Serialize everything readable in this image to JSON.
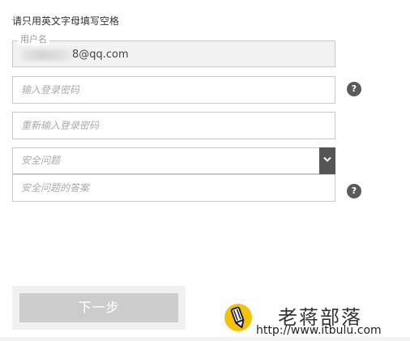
{
  "instruction": "请只用英文字母填写空格",
  "username": {
    "label": "用户名",
    "value": "8@qq.com"
  },
  "password": {
    "placeholder": "输入登录密码"
  },
  "confirm_password": {
    "placeholder": "重新输入登录密码"
  },
  "security_question": {
    "placeholder": "安全问题"
  },
  "security_answer": {
    "placeholder": "安全问题的答案"
  },
  "help_icon_text": "?",
  "next_button": {
    "label": "下一步"
  },
  "watermark": {
    "title": "老蒋部落",
    "url": "http://www.itbulu.com"
  },
  "colors": {
    "border": "#c9c9c9",
    "disabled_button": "#cccccc",
    "help_icon": "#5a5a5a",
    "logo_yellow": "#f4c20d"
  }
}
